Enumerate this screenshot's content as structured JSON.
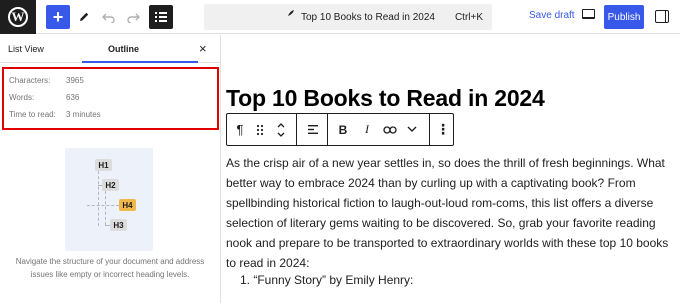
{
  "toolbar": {
    "logo_letter": "W",
    "add_icon": "+",
    "tools_icon": "pencil-icon",
    "undo_icon": "undo-icon",
    "redo_icon": "redo-icon",
    "document_title": "Top 10 Books to Read in 2024",
    "shortcut": "Ctrl+K",
    "save_draft_label": "Save draft",
    "publish_label": "Publish",
    "accent_color": "#3858e9"
  },
  "left_panel": {
    "tabs": [
      {
        "label": "List View",
        "active": false
      },
      {
        "label": "Outline",
        "active": true
      }
    ],
    "close_icon": "×",
    "stats": [
      {
        "label": "Characters:",
        "value": "3965"
      },
      {
        "label": "Words:",
        "value": "636"
      },
      {
        "label": "Time to read:",
        "value": "3 minutes"
      }
    ],
    "illustration_headings": [
      "H1",
      "H2",
      "H4",
      "H3"
    ],
    "help_text": "Navigate the structure of your document and address issues like empty or incorrect heading levels."
  },
  "editor": {
    "title": "Top 10 Books to Read in 2024",
    "paragraph": "As the crisp air of a new year settles in, so does the thrill of fresh beginnings. What better way to embrace 2024 than by curling up with a captivating book? From spellbinding historical fiction to laugh-out-loud rom-coms, this list offers a diverse selection of literary gems waiting to be discovered. So, grab your favorite reading nook and prepare to be transported to extraordinary worlds with these top 10 books to read in 2024:",
    "list_item": "1.  “Funny Story” by Emily Henry:"
  },
  "block_toolbar": {
    "paragraph_icon": "¶",
    "bold_label": "B",
    "italic_label": "I",
    "more_icon": "⋮"
  }
}
